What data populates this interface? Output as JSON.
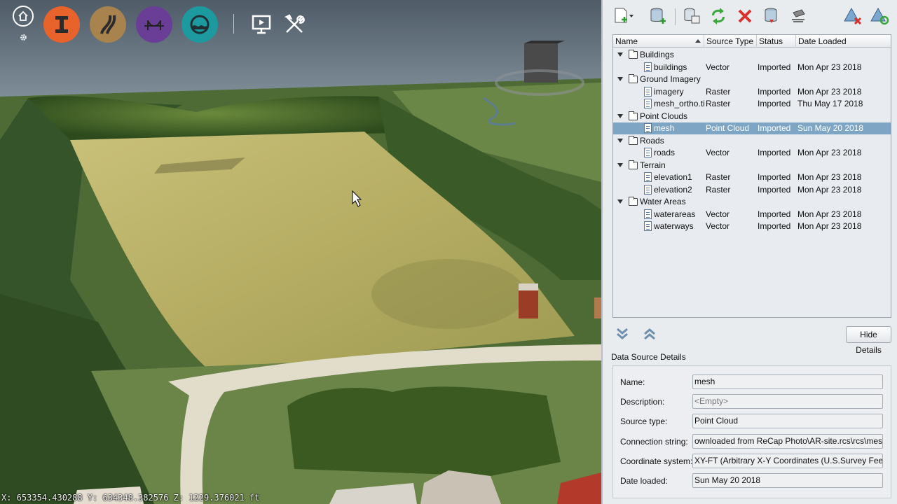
{
  "viewport": {
    "coordinates": "X: 653354.430288 Y: 634348.382576 Z: 1229.376021 ft",
    "toolbar": {
      "buttons": [
        {
          "name": "home-icon",
          "color": "#ffffff"
        },
        {
          "name": "buildings-icon",
          "color": "#e8622c"
        },
        {
          "name": "roads-icon",
          "color": "#a8834e"
        },
        {
          "name": "bridges-icon",
          "color": "#6a3e96"
        },
        {
          "name": "water-icon",
          "color": "#1c9aa0"
        },
        {
          "name": "presentation-icon",
          "color": "#ffffff"
        },
        {
          "name": "tools-icon",
          "color": "#ffffff"
        }
      ]
    }
  },
  "panel": {
    "toolbar_icons": [
      "new-file-icon",
      "add-database-icon",
      "database-settings-icon",
      "refresh-icon",
      "remove-icon",
      "database-upload-icon",
      "erase-icon",
      "warning-remove-icon",
      "triangle-refresh-icon"
    ],
    "columns": [
      "Name",
      "Source Type",
      "Status",
      "Date Loaded"
    ],
    "groups": [
      {
        "name": "Buildings",
        "items": [
          {
            "name": "buildings",
            "type": "Vector",
            "status": "Imported",
            "date": "Mon Apr 23 2018"
          }
        ]
      },
      {
        "name": "Ground Imagery",
        "items": [
          {
            "name": "imagery",
            "type": "Raster",
            "status": "Imported",
            "date": "Mon Apr 23 2018"
          },
          {
            "name": "mesh_ortho.tif",
            "type": "Raster",
            "status": "Imported",
            "date": "Thu May 17 2018"
          }
        ]
      },
      {
        "name": "Point Clouds",
        "items": [
          {
            "name": "mesh",
            "type": "Point Cloud",
            "status": "Imported",
            "date": "Sun May 20 2018",
            "selected": true
          }
        ]
      },
      {
        "name": "Roads",
        "items": [
          {
            "name": "roads",
            "type": "Vector",
            "status": "Imported",
            "date": "Mon Apr 23 2018"
          }
        ]
      },
      {
        "name": "Terrain",
        "items": [
          {
            "name": "elevation1",
            "type": "Raster",
            "status": "Imported",
            "date": "Mon Apr 23 2018"
          },
          {
            "name": "elevation2",
            "type": "Raster",
            "status": "Imported",
            "date": "Mon Apr 23 2018"
          }
        ]
      },
      {
        "name": "Water Areas",
        "items": [
          {
            "name": "waterareas",
            "type": "Vector",
            "status": "Imported",
            "date": "Mon Apr 23 2018"
          },
          {
            "name": "waterways",
            "type": "Vector",
            "status": "Imported",
            "date": "Mon Apr 23 2018"
          }
        ]
      }
    ],
    "hide_details_label": "Hide Details",
    "details_title": "Data Source Details",
    "details": {
      "name_label": "Name:",
      "name_value": "mesh",
      "description_label": "Description:",
      "description_value": "<Empty>",
      "source_type_label": "Source type:",
      "source_type_value": "Point Cloud",
      "connection_label": "Connection string:",
      "connection_value": "ownloaded from ReCap Photo\\AR-site.rcs\\rcs\\mesh.rcp",
      "coord_label": "Coordinate system:",
      "coord_value": "XY-FT (Arbitrary X-Y Coordinates (U.S.Survey Feet))",
      "date_label": "Date loaded:",
      "date_value": "Sun May 20 2018"
    },
    "selection_color": "#7ea6c4"
  }
}
